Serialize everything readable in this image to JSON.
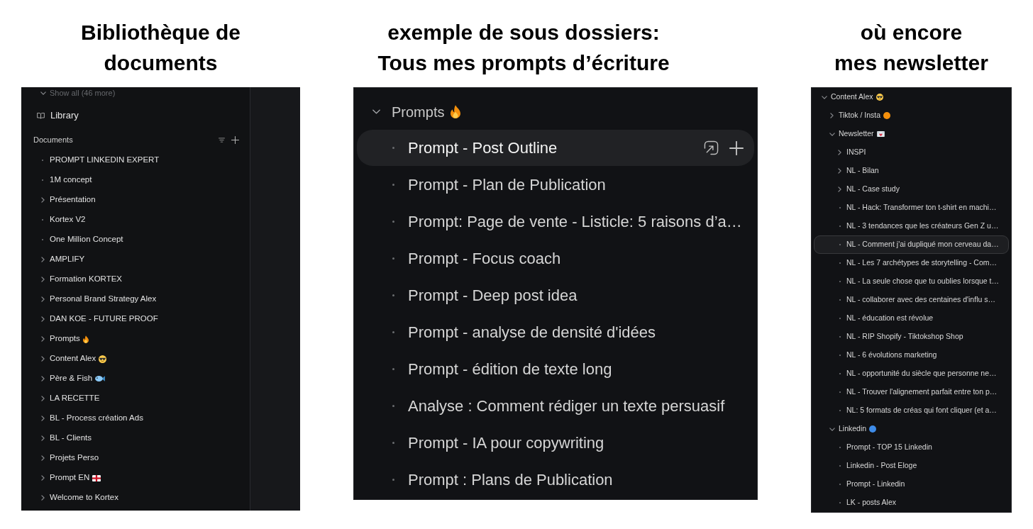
{
  "library_view": {
    "caption": "Bibliothèque de\ndocuments",
    "sidebar": {
      "show_all": "Show all (46 more)",
      "library": "Library",
      "section": "Documents",
      "items": [
        {
          "label": "PROMPT LINKEDIN EXPERT",
          "kind": "page"
        },
        {
          "label": "1M concept",
          "kind": "page"
        },
        {
          "label": "Présentation",
          "kind": "folder",
          "expanded": false
        },
        {
          "label": "Kortex V2",
          "kind": "page"
        },
        {
          "label": "One Million Concept",
          "kind": "page"
        },
        {
          "label": "AMPLIFY",
          "kind": "folder",
          "expanded": false
        },
        {
          "label": "Formation KORTEX",
          "kind": "folder",
          "expanded": false
        },
        {
          "label": "Personal Brand Strategy Alex",
          "kind": "folder",
          "expanded": false
        },
        {
          "label": "DAN KOE - FUTURE PROOF",
          "kind": "folder",
          "expanded": false
        },
        {
          "label": "Prompts",
          "badge": {
            "kind": "fire"
          },
          "kind": "folder",
          "expanded": false
        },
        {
          "label": "Content Alex",
          "badge": {
            "kind": "sunglasses"
          },
          "kind": "folder",
          "expanded": false
        },
        {
          "label": "Père & Fish",
          "badge": {
            "kind": "fish"
          },
          "kind": "folder",
          "expanded": false
        },
        {
          "label": "LA RECETTE",
          "kind": "folder",
          "expanded": false
        },
        {
          "label": "BL - Process création Ads",
          "kind": "folder",
          "expanded": false
        },
        {
          "label": "BL - Clients",
          "kind": "folder",
          "expanded": false
        },
        {
          "label": "Projets Perso",
          "kind": "folder",
          "expanded": false
        },
        {
          "label": "Prompt EN",
          "badge": {
            "kind": "flag"
          },
          "kind": "folder",
          "expanded": false
        },
        {
          "label": "Welcome to Kortex",
          "kind": "folder",
          "expanded": false
        }
      ]
    }
  },
  "prompts_view": {
    "caption": "exemple de sous dossiers:\nTous mes prompts d’écriture",
    "folder": {
      "label": "Prompts",
      "badge": {
        "kind": "fire"
      },
      "kind": "folder",
      "expanded": true,
      "children": [
        {
          "label": "Prompt - Post Outline",
          "kind": "page",
          "selected": true
        },
        {
          "label": "Prompt - Plan de Publication",
          "kind": "page",
          "selected": false
        },
        {
          "label": "Prompt: Page de vente - Listicle: 5 raisons d’a…",
          "kind": "page",
          "selected": false
        },
        {
          "label": "Prompt - Focus coach",
          "kind": "page",
          "selected": false
        },
        {
          "label": "Prompt - Deep post idea",
          "kind": "page",
          "selected": false
        },
        {
          "label": "Prompt - analyse de densité d'idées",
          "kind": "page",
          "selected": false
        },
        {
          "label": "Prompt - édition de texte long",
          "kind": "page",
          "selected": false
        },
        {
          "label": "Analyse : Comment rédiger un texte persuasif",
          "kind": "page",
          "selected": false
        },
        {
          "label": "Prompt - IA pour copywriting",
          "kind": "page",
          "selected": false
        },
        {
          "label": "Prompt : Plans de Publication",
          "kind": "page",
          "selected": false
        }
      ]
    }
  },
  "newsletter_view": {
    "caption": "où encore\nmes newsletter",
    "tree": [
      {
        "label": "Content Alex",
        "badge": {
          "kind": "sunglasses"
        },
        "kind": "folder",
        "expanded": true,
        "selected": false,
        "children": [
          {
            "label": "Tiktok / Insta",
            "badge": {
              "kind": "dot",
              "color": "#f4900c"
            },
            "kind": "folder",
            "expanded": false,
            "selected": false
          },
          {
            "label": "Newsletter",
            "badge": {
              "kind": "letter"
            },
            "kind": "folder",
            "expanded": true,
            "selected": false,
            "children": [
              {
                "label": "INSPI",
                "kind": "folder",
                "expanded": false,
                "selected": false
              },
              {
                "label": "NL - Bilan",
                "kind": "folder",
                "expanded": false,
                "selected": false
              },
              {
                "label": "NL - Case study",
                "kind": "folder",
                "expanded": false,
                "selected": false
              },
              {
                "label": "NL - Hack: Transformer ton t-shirt en machi…",
                "kind": "page",
                "selected": false
              },
              {
                "label": "NL - 3 tendances que les créateurs Gen Z u…",
                "kind": "page",
                "selected": false
              },
              {
                "label": "NL - Comment j'ai dupliqué mon cerveau da…",
                "kind": "page",
                "selected": true
              },
              {
                "label": "NL - Les 7 archétypes de storytelling - Com…",
                "kind": "page",
                "selected": false
              },
              {
                "label": "NL - La seule chose que tu oublies lorsque t…",
                "kind": "page",
                "selected": false
              },
              {
                "label": "NL - collaborer avec des centaines d'influ s…",
                "kind": "page",
                "selected": false
              },
              {
                "label": "NL - éducation est révolue",
                "kind": "page",
                "selected": false
              },
              {
                "label": "NL - RIP Shopify - Tiktokshop Shop",
                "kind": "page",
                "selected": false
              },
              {
                "label": "NL - 6 évolutions marketing",
                "kind": "page",
                "selected": false
              },
              {
                "label": "NL - opportunité du siècle que personne ne…",
                "kind": "page",
                "selected": false
              },
              {
                "label": "NL - Trouver l'alignement parfait entre ton p…",
                "kind": "page",
                "selected": false
              },
              {
                "label": "NL: 5 formats de créas qui font cliquer (et a…",
                "kind": "page",
                "selected": false
              }
            ]
          },
          {
            "label": "Linkedin",
            "badge": {
              "kind": "dot",
              "color": "#3e8be8"
            },
            "kind": "folder",
            "expanded": true,
            "selected": false,
            "children": [
              {
                "label": "Prompt - TOP 15 Linkedin",
                "kind": "page",
                "selected": false
              },
              {
                "label": "Linkedin - Post Eloge",
                "kind": "page",
                "selected": false
              },
              {
                "label": "Prompt - Linkedin",
                "kind": "page",
                "selected": false
              },
              {
                "label": "LK - posts Alex",
                "kind": "page",
                "selected": false
              }
            ]
          }
        ]
      }
    ]
  }
}
